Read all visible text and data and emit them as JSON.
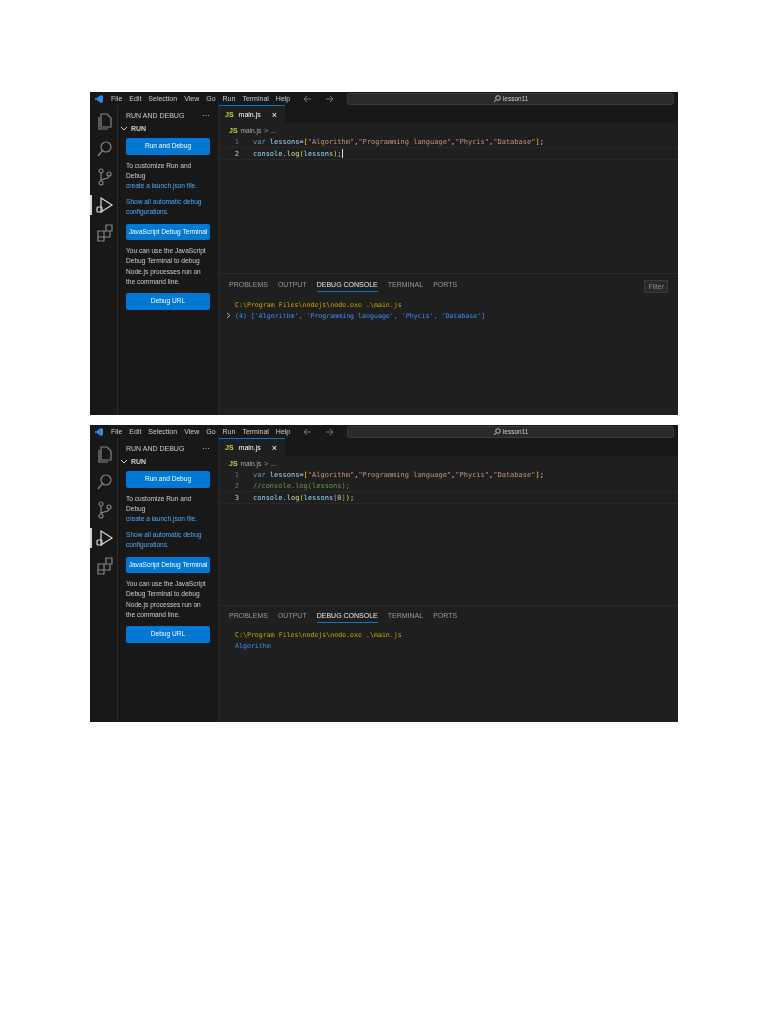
{
  "screenshots": [
    {
      "menu": [
        "File",
        "Edit",
        "Selection",
        "View",
        "Go",
        "Run",
        "Terminal",
        "Help"
      ],
      "search": "lesson11",
      "activity": [
        {
          "kind": "files",
          "selected": false
        },
        {
          "kind": "search",
          "selected": false
        },
        {
          "kind": "branch",
          "selected": false
        },
        {
          "kind": "debug",
          "selected": true
        },
        {
          "kind": "extensions",
          "selected": false
        }
      ],
      "sidebar": {
        "title": "RUN AND DEBUG",
        "more": "···",
        "section": "RUN",
        "blocks": [
          {
            "kind": "button",
            "text": "Run and Debug"
          },
          {
            "kind": "text",
            "text": "To customize Run and Debug",
            "link": "create a launch.json file."
          },
          {
            "kind": "link",
            "text": "Show all automatic debug configurations."
          },
          {
            "kind": "button",
            "text": "JavaScript Debug Terminal"
          },
          {
            "kind": "text",
            "text": "You can use the JavaScript Debug Terminal to debug Node.js processes run on the command line."
          },
          {
            "kind": "button",
            "text": "Debug URL"
          }
        ]
      },
      "tab": {
        "badge": "JS",
        "label": "main.js",
        "close": "×"
      },
      "breadcrumb": {
        "badge": "JS",
        "file": "main.js",
        "sep": ">",
        "rest": "..."
      },
      "code": [
        {
          "number": "1",
          "active": false,
          "cursor": false,
          "tokens": [
            {
              "kind": "keyword",
              "text": "var"
            },
            {
              "kind": "variable",
              "text": " lessons"
            },
            {
              "kind": "operator",
              "text": "="
            },
            {
              "kind": "bracket",
              "text": "["
            },
            {
              "kind": "string",
              "text": "\"Algorithm\""
            },
            {
              "kind": "operator",
              "text": ","
            },
            {
              "kind": "string",
              "text": "\"Programming language\""
            },
            {
              "kind": "operator",
              "text": ","
            },
            {
              "kind": "string",
              "text": "\"Phycis\""
            },
            {
              "kind": "operator",
              "text": ","
            },
            {
              "kind": "string",
              "text": "\"Database\""
            },
            {
              "kind": "bracket",
              "text": "]"
            },
            {
              "kind": "operator",
              "text": ";"
            }
          ]
        },
        {
          "number": "2",
          "active": true,
          "cursor": true,
          "tokens": [
            {
              "kind": "variable",
              "text": "console"
            },
            {
              "kind": "operator",
              "text": "."
            },
            {
              "kind": "function",
              "text": "log"
            },
            {
              "kind": "bracket",
              "text": "("
            },
            {
              "kind": "variable",
              "text": "lessons"
            },
            {
              "kind": "bracket",
              "text": ")"
            },
            {
              "kind": "operator",
              "text": ";"
            }
          ]
        }
      ],
      "panel_tabs": [
        {
          "label": "PROBLEMS",
          "selected": false
        },
        {
          "label": "OUTPUT",
          "selected": false
        },
        {
          "label": "DEBUG CONSOLE",
          "selected": true
        },
        {
          "label": "TERMINAL",
          "selected": false
        },
        {
          "label": "PORTS",
          "selected": false
        }
      ],
      "filter": "Filter",
      "output": [
        {
          "kind": "command",
          "expandable": false,
          "text": "C:\\Program Files\\nodejs\\node.exe .\\main.js"
        },
        {
          "kind": "result",
          "expandable": true,
          "text": "(4) ['Algorithm', 'Programming language', 'Phycis', 'Database']"
        }
      ]
    },
    {
      "menu": [
        "File",
        "Edit",
        "Selection",
        "View",
        "Go",
        "Run",
        "Terminal",
        "Help"
      ],
      "search": "lesson11",
      "activity": [
        {
          "kind": "files",
          "selected": false
        },
        {
          "kind": "search",
          "selected": false
        },
        {
          "kind": "branch",
          "selected": false
        },
        {
          "kind": "debug",
          "selected": true
        },
        {
          "kind": "extensions",
          "selected": false
        }
      ],
      "sidebar": {
        "title": "RUN AND DEBUG",
        "more": "···",
        "section": "RUN",
        "blocks": [
          {
            "kind": "button",
            "text": "Run and Debug"
          },
          {
            "kind": "text",
            "text": "To customize Run and Debug",
            "link": "create a launch.json file."
          },
          {
            "kind": "link",
            "text": "Show all automatic debug configurations."
          },
          {
            "kind": "button",
            "text": "JavaScript Debug Terminal"
          },
          {
            "kind": "text",
            "text": "You can use the JavaScript Debug Terminal to debug Node.js processes run on the command line."
          },
          {
            "kind": "button",
            "text": "Debug URL"
          }
        ]
      },
      "tab": {
        "badge": "JS",
        "label": "main.js",
        "close": "×"
      },
      "breadcrumb": {
        "badge": "JS",
        "file": "main.js",
        "sep": ">",
        "rest": "..."
      },
      "code": [
        {
          "number": "1",
          "active": false,
          "cursor": false,
          "tokens": [
            {
              "kind": "keyword",
              "text": "var"
            },
            {
              "kind": "variable",
              "text": " lessons"
            },
            {
              "kind": "operator",
              "text": "="
            },
            {
              "kind": "bracket",
              "text": "["
            },
            {
              "kind": "string",
              "text": "\"Algorithm\""
            },
            {
              "kind": "operator",
              "text": ","
            },
            {
              "kind": "string",
              "text": "\"Programming language\""
            },
            {
              "kind": "operator",
              "text": ","
            },
            {
              "kind": "string",
              "text": "\"Phycis\""
            },
            {
              "kind": "operator",
              "text": ","
            },
            {
              "kind": "string",
              "text": "\"Database\""
            },
            {
              "kind": "bracket",
              "text": "]"
            },
            {
              "kind": "operator",
              "text": ";"
            }
          ]
        },
        {
          "number": "2",
          "active": false,
          "cursor": false,
          "tokens": [
            {
              "kind": "comment",
              "text": "//console.log(lessons);"
            }
          ]
        },
        {
          "number": "3",
          "active": true,
          "cursor": false,
          "tokens": [
            {
              "kind": "variable",
              "text": "console"
            },
            {
              "kind": "operator",
              "text": "."
            },
            {
              "kind": "function",
              "text": "log"
            },
            {
              "kind": "bracket",
              "text": "("
            },
            {
              "kind": "variable",
              "text": "lessons"
            },
            {
              "kind": "bracket2",
              "text": "["
            },
            {
              "kind": "number",
              "text": "0"
            },
            {
              "kind": "bracket2",
              "text": "]"
            },
            {
              "kind": "bracket",
              "text": ")"
            },
            {
              "kind": "operator",
              "text": ";"
            }
          ]
        }
      ],
      "panel_tabs": [
        {
          "label": "PROBLEMS",
          "selected": false
        },
        {
          "label": "OUTPUT",
          "selected": false
        },
        {
          "label": "DEBUG CONSOLE",
          "selected": true
        },
        {
          "label": "TERMINAL",
          "selected": false
        },
        {
          "label": "PORTS",
          "selected": false
        }
      ],
      "output": [
        {
          "kind": "command",
          "expandable": false,
          "text": "C:\\Program Files\\nodejs\\node.exe .\\main.js"
        },
        {
          "kind": "result",
          "expandable": false,
          "text": "Algorithm"
        }
      ]
    }
  ]
}
